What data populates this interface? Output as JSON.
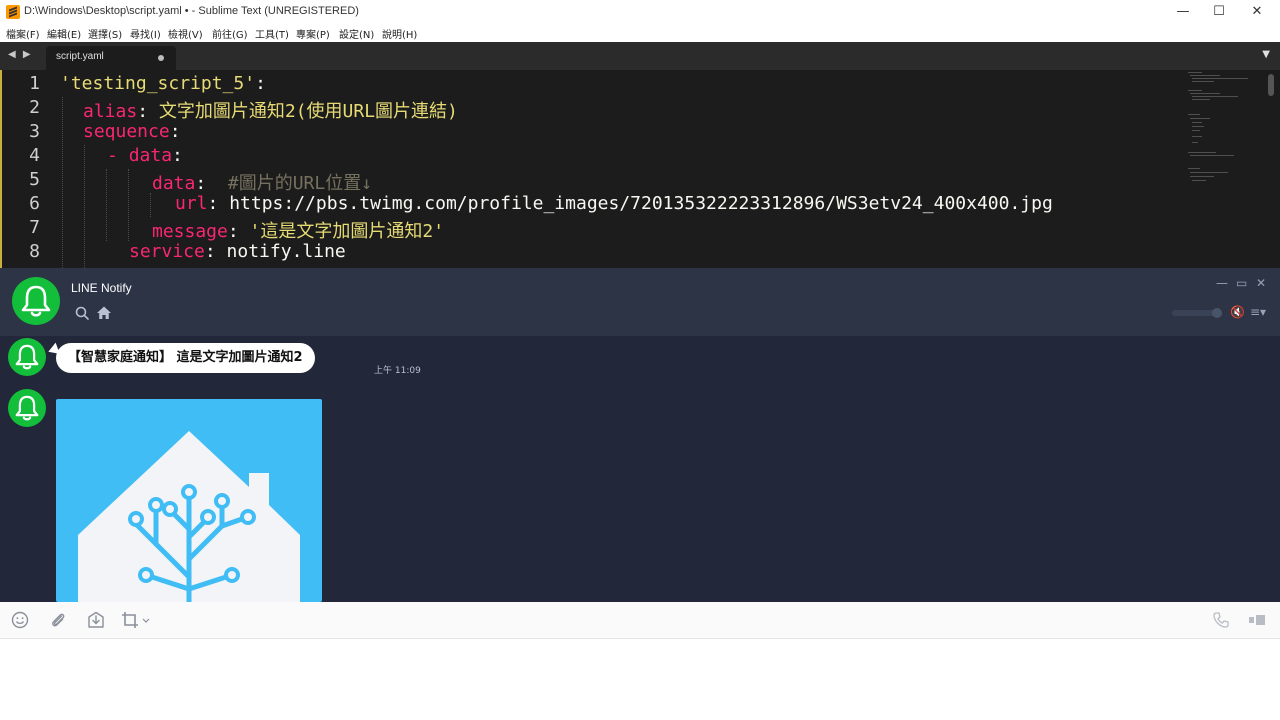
{
  "sublime": {
    "title": "D:\\Windows\\Desktop\\script.yaml • - Sublime Text (UNREGISTERED)",
    "window_controls": {
      "minimize": "—",
      "maximize": "☐",
      "close": "✕"
    },
    "menu": [
      "檔案(F)",
      "編輯(E)",
      "選擇(S)",
      "尋找(I)",
      "檢視(V)",
      "前往(G)",
      "工具(T)",
      "專案(P)",
      "設定(N)",
      "說明(H)"
    ],
    "nav_arrows": "◀ ▶",
    "tab": {
      "label": "script.yaml",
      "modified": true
    },
    "tab_dropdown": "▼",
    "line_numbers": [
      "1",
      "2",
      "3",
      "4",
      "5",
      "6",
      "7",
      "8"
    ],
    "code": {
      "l1": {
        "key": "'testing_script_5'",
        "colon": ":"
      },
      "l2": {
        "key": "alias",
        "colon": ": ",
        "value": "文字加圖片通知2(使用URL圖片連結)"
      },
      "l3": {
        "key": "sequence",
        "colon": ":"
      },
      "l4": {
        "dash": "- ",
        "key": "data",
        "colon": ":"
      },
      "l5": {
        "key": "data",
        "colon": ":  ",
        "comment": "#圖片的URL位置↓"
      },
      "l6": {
        "key": "url",
        "colon": ": ",
        "value": "https://pbs.twimg.com/profile_images/720135322223312896/WS3etv24_400x400.jpg"
      },
      "l7": {
        "key": "message",
        "colon": ": ",
        "value": "'這是文字加圖片通知2'"
      },
      "l8": {
        "key": "service",
        "colon": ": ",
        "value": "notify.line"
      }
    },
    "colors": {
      "keyword": "#f92672",
      "string": "#e6db74",
      "comment": "#75715e",
      "background": "#1c1c1c"
    }
  },
  "line": {
    "title": "LINE Notify",
    "window_controls": {
      "minimize": "—",
      "maximize": "▭",
      "close": "✕"
    },
    "icons": {
      "search": "search-icon",
      "home": "home-icon",
      "mute": "mute-icon",
      "menu": "menu-icon"
    },
    "mute_glyph": "🔇",
    "menu_glyph": "≡▾",
    "messages": [
      {
        "text": "【智慧家庭通知】 這是文字加圖片通知2",
        "time": "上午 11:09"
      },
      {
        "image": "home-assistant-logo"
      }
    ],
    "scroll_down": "↓",
    "toolbar": [
      "emoji-icon",
      "attach-icon",
      "save-icon",
      "crop-icon",
      "call-icon",
      "video-icon"
    ],
    "colors": {
      "brand": "#13be3b",
      "header": "#2c3446",
      "chat_bg": "#22283a",
      "image_bg": "#41bdf5"
    }
  }
}
